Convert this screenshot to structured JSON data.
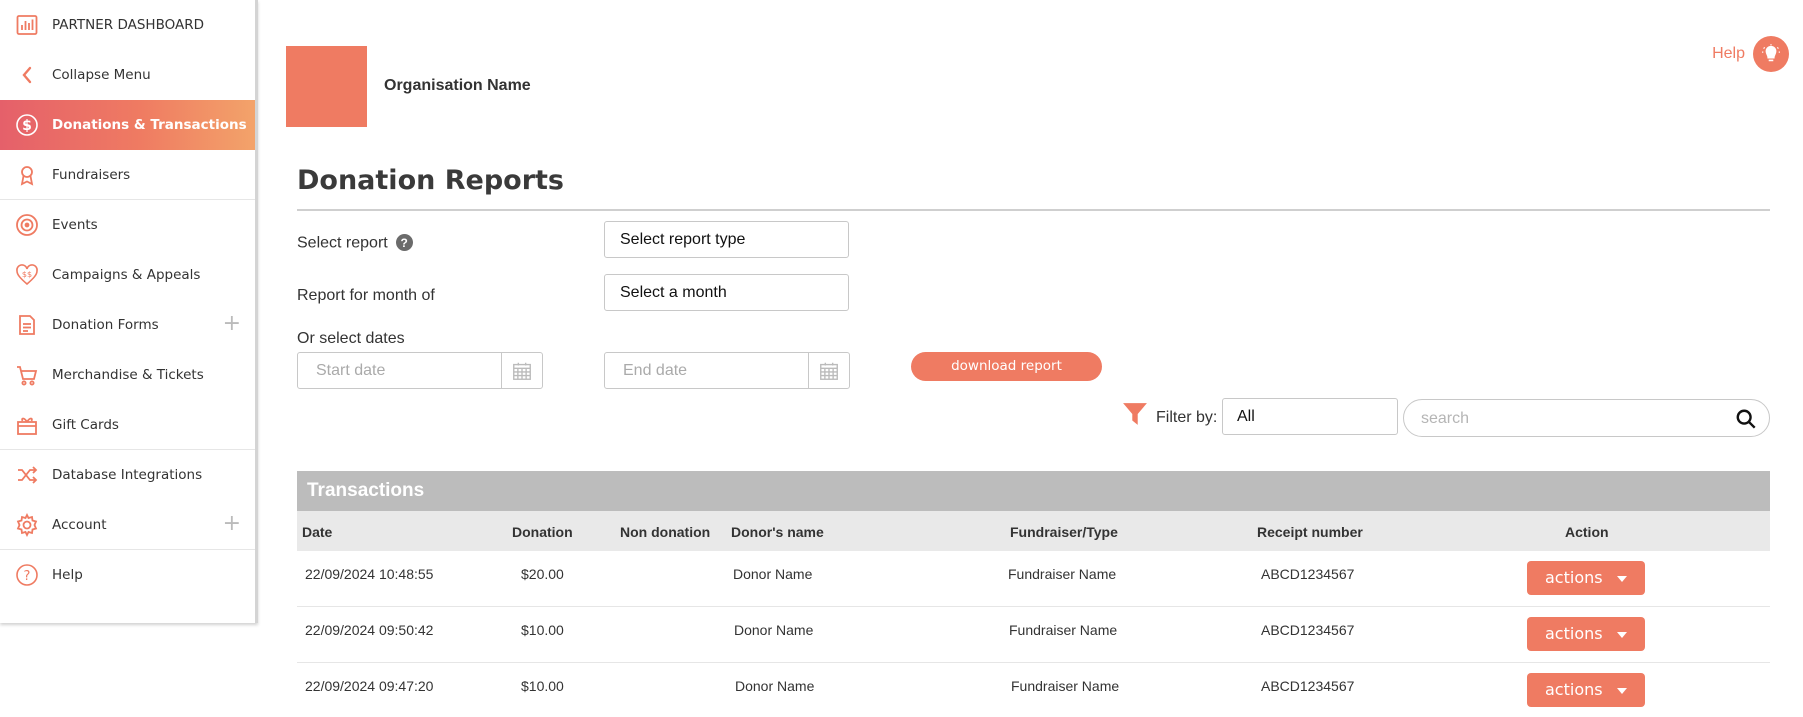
{
  "sidebar": {
    "items": [
      {
        "label": "PARTNER DASHBOARD",
        "icon": "bar-chart-icon"
      },
      {
        "label": "Collapse Menu",
        "icon": "chevron-left-icon"
      },
      {
        "label": "Donations & Transactions",
        "icon": "dollar-circle-icon",
        "active": true
      },
      {
        "label": "Fundraisers",
        "icon": "ribbon-icon"
      },
      {
        "label": "Events",
        "icon": "target-icon"
      },
      {
        "label": "Campaigns & Appeals",
        "icon": "heart-dollar-icon"
      },
      {
        "label": "Donation Forms",
        "icon": "document-icon",
        "expand": "+"
      },
      {
        "label": "Merchandise & Tickets",
        "icon": "cart-icon"
      },
      {
        "label": "Gift Cards",
        "icon": "gift-icon"
      },
      {
        "label": "Database Integrations",
        "icon": "shuffle-icon"
      },
      {
        "label": "Account",
        "icon": "gear-icon",
        "expand": "+"
      },
      {
        "label": "Help",
        "icon": "question-circle-icon"
      }
    ]
  },
  "header": {
    "org_name": "Organisation Name",
    "help_label": "Help"
  },
  "main": {
    "title": "Donation Reports",
    "select_report_label": "Select report",
    "select_report_value": "Select report type",
    "month_label": "Report for month of",
    "month_value": "Select a month",
    "dates_label": "Or select dates",
    "start_date_placeholder": "Start date",
    "end_date_placeholder": "End date",
    "download_label": "download report",
    "filter_label": "Filter by:",
    "filter_value": "All",
    "search_placeholder": "search"
  },
  "table": {
    "title": "Transactions",
    "columns": [
      "Date",
      "Donation",
      "Non donation",
      "Donor's name",
      "Fundraiser/Type",
      "Receipt number",
      "Action"
    ],
    "rows": [
      {
        "date": "22/09/2024 10:48:55",
        "donation": "$20.00",
        "non_donation": "",
        "donor": "Donor Name",
        "fundraiser": "Fundraiser Name",
        "receipt": "ABCD1234567",
        "action": "actions"
      },
      {
        "date": "22/09/2024 09:50:42",
        "donation": "$10.00",
        "non_donation": "",
        "donor": "Donor Name",
        "fundraiser": "Fundraiser Name",
        "receipt": "ABCD1234567",
        "action": "actions"
      },
      {
        "date": "22/09/2024 09:47:20",
        "donation": "$10.00",
        "non_donation": "",
        "donor": "Donor Name",
        "fundraiser": "Fundraiser Name",
        "receipt": "ABCD1234567",
        "action": "actions"
      }
    ]
  },
  "colors": {
    "accent": "#ef7b62",
    "active_gradient_start": "#e5606a",
    "active_gradient_end": "#f3a36a",
    "table_header": "#bcbcbc",
    "column_header": "#e9e9e9"
  }
}
